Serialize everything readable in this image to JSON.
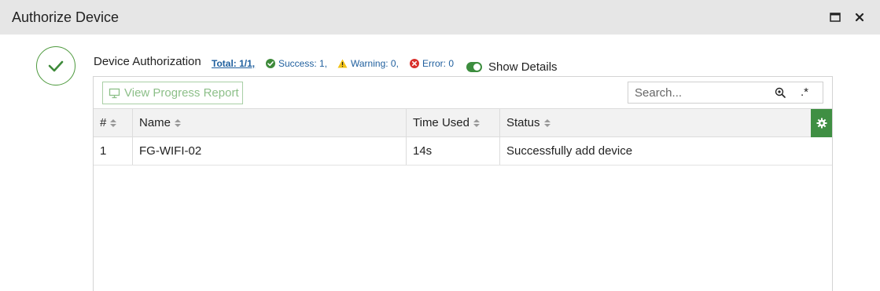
{
  "window": {
    "title": "Authorize Device",
    "maximize_icon": "maximize-icon",
    "close_icon": "close-icon"
  },
  "summary": {
    "heading": "Device Authorization",
    "total": "Total: 1/1,",
    "success": "Success: 1,",
    "warning": "Warning: 0,",
    "error": "Error: 0",
    "show_details": "Show Details",
    "show_details_on": true
  },
  "toolbar": {
    "report_button": "View Progress Report",
    "search_placeholder": "Search...",
    "regex_label": ".*"
  },
  "table": {
    "columns": [
      "#",
      "Name",
      "Time Used",
      "Status"
    ],
    "rows": [
      {
        "index": "1",
        "name": "FG-WIFI-02",
        "time_used": "14s",
        "status": "Successfully add device"
      }
    ]
  },
  "colors": {
    "accent_green": "#3f8f43",
    "link_blue": "#1f5f9e",
    "warning_yellow": "#f2c318",
    "error_red": "#d9302c"
  }
}
